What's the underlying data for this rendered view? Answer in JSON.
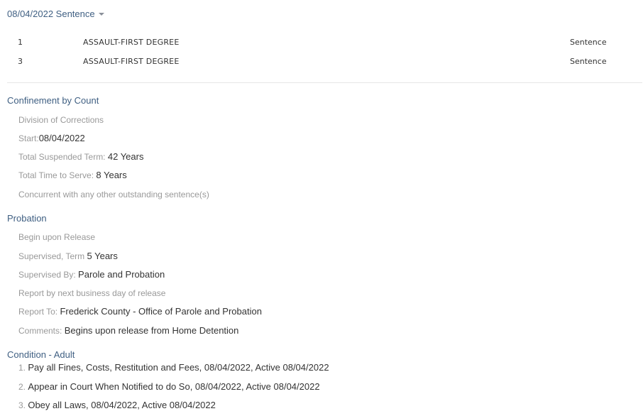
{
  "header": {
    "title": "08/04/2022 Sentence"
  },
  "counts": [
    {
      "number": "1",
      "charge": "ASSAULT-FIRST DEGREE",
      "type": "Sentence"
    },
    {
      "number": "3",
      "charge": "ASSAULT-FIRST DEGREE",
      "type": "Sentence"
    }
  ],
  "confinement": {
    "title": "Confinement by Count",
    "division": "Division of Corrections",
    "start_label": "Start:",
    "start_value": "08/04/2022",
    "suspended_label": "Total Suspended Term: ",
    "suspended_value": "42 Years",
    "serve_label": "Total Time to Serve: ",
    "serve_value": "8 Years",
    "concurrent": "Concurrent with any other outstanding sentence(s)"
  },
  "probation": {
    "title": "Probation",
    "begin": "Begin upon Release",
    "supervised_label": "Supervised, Term ",
    "supervised_value": "5 Years",
    "by_label": "Supervised By: ",
    "by_value": "Parole and Probation",
    "report_next": "Report by next business day of release",
    "report_to_label": "Report To: ",
    "report_to_value": "Frederick County - Office of Parole and Probation",
    "comments_label": "Comments: ",
    "comments_value": "Begins upon release from Home Detention"
  },
  "conditions": {
    "title": "Condition - Adult",
    "items": [
      {
        "index": "1. ",
        "text": "Pay all Fines, Costs, Restitution and Fees, 08/04/2022, Active 08/04/2022"
      },
      {
        "index": "2. ",
        "text": "Appear in Court When Notified to do So, 08/04/2022, Active 08/04/2022"
      },
      {
        "index": "3. ",
        "text": "Obey all Laws, 08/04/2022, Active 08/04/2022"
      }
    ]
  }
}
